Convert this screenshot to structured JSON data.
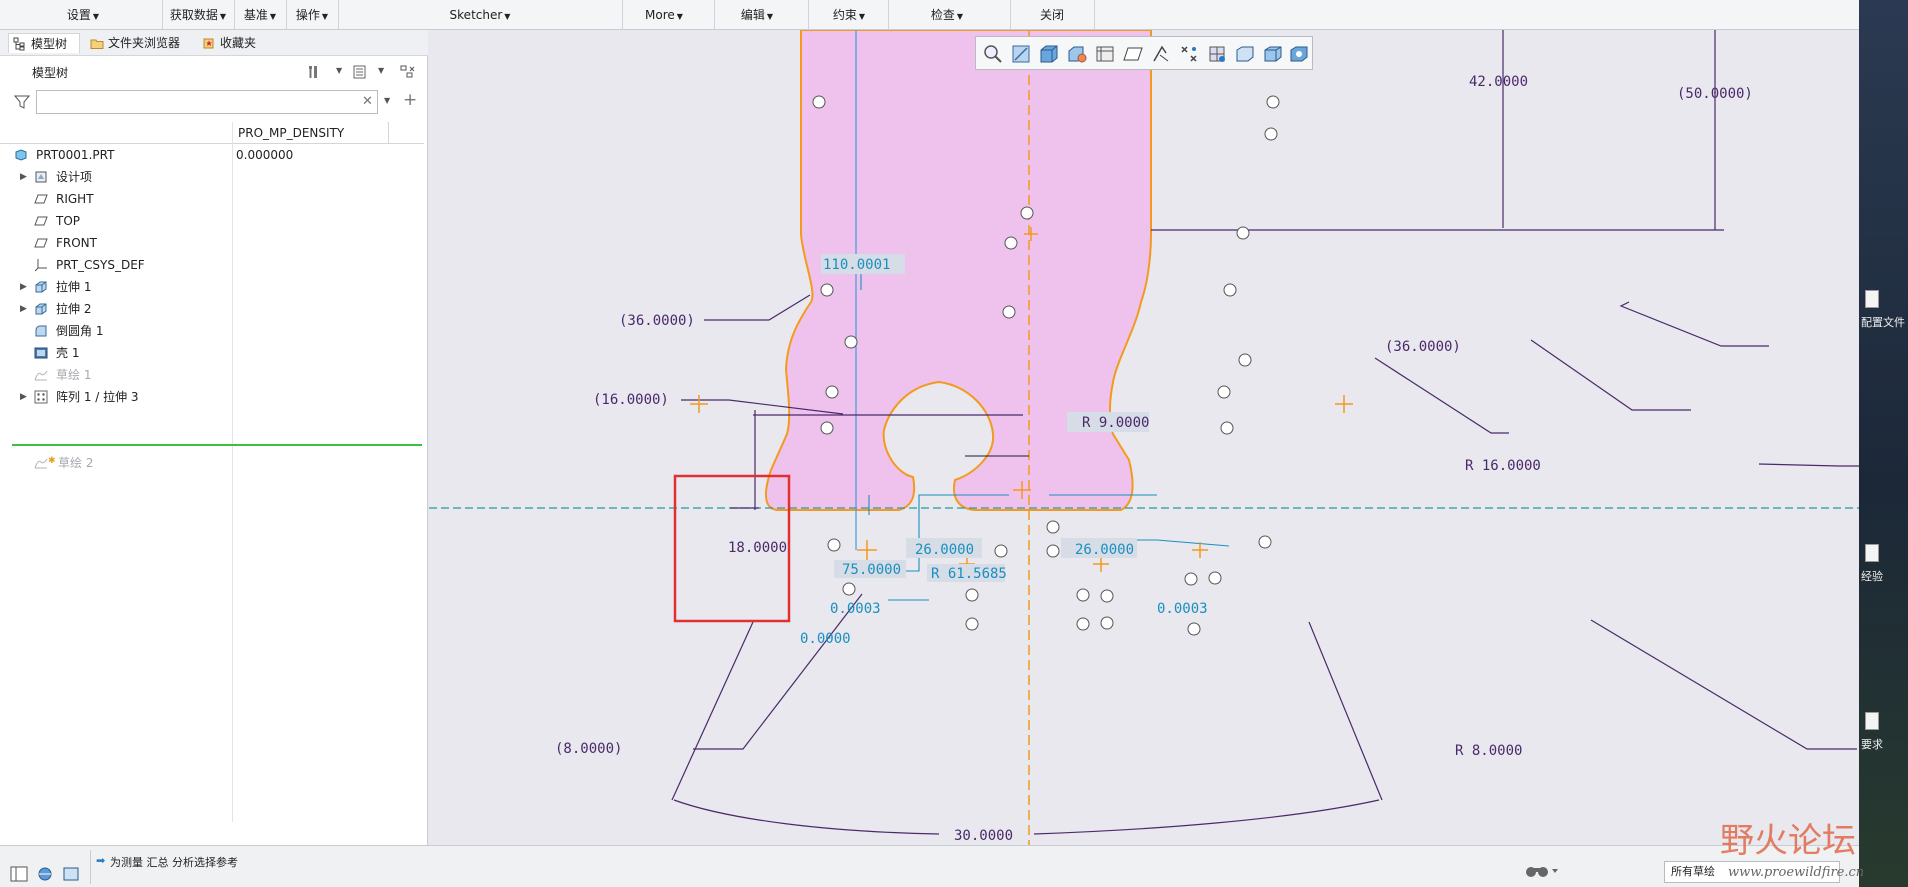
{
  "menubar": {
    "items": [
      {
        "label": "设置",
        "caret": true
      },
      {
        "label": "获取数据",
        "caret": true
      },
      {
        "label": "基准",
        "caret": true
      },
      {
        "label": "操作",
        "caret": true
      },
      {
        "label": "Sketcher",
        "caret": true
      },
      {
        "label": "More",
        "caret": true
      },
      {
        "label": "编辑",
        "caret": true
      },
      {
        "label": "约束",
        "caret": true
      },
      {
        "label": "检查",
        "caret": true
      },
      {
        "label": "关闭",
        "caret": false
      }
    ]
  },
  "panel": {
    "tabs": [
      {
        "label": "模型树",
        "icon": "tree-icon",
        "active": true
      },
      {
        "label": "文件夹浏览器",
        "icon": "folder-icon",
        "active": false
      },
      {
        "label": "收藏夹",
        "icon": "star-icon",
        "active": false
      }
    ],
    "tree_title": "模型树",
    "search_placeholder": "",
    "column_header": "PRO_MP_DENSITY",
    "tree_rows": [
      {
        "label": "PRT0001.PRT",
        "value": "0.000000",
        "icon": "part-icon",
        "expandable": false,
        "indent": 0,
        "dim": false
      },
      {
        "label": "设计项",
        "value": "",
        "icon": "design-items-icon",
        "expandable": true,
        "indent": 1,
        "dim": false
      },
      {
        "label": "RIGHT",
        "value": "",
        "icon": "datum-plane-icon",
        "expandable": false,
        "indent": 1,
        "dim": false
      },
      {
        "label": "TOP",
        "value": "",
        "icon": "datum-plane-icon",
        "expandable": false,
        "indent": 1,
        "dim": false
      },
      {
        "label": "FRONT",
        "value": "",
        "icon": "datum-plane-icon",
        "expandable": false,
        "indent": 1,
        "dim": false
      },
      {
        "label": "PRT_CSYS_DEF",
        "value": "",
        "icon": "csys-icon",
        "expandable": false,
        "indent": 1,
        "dim": false
      },
      {
        "label": "拉伸 1",
        "value": "",
        "icon": "extrude-icon",
        "expandable": true,
        "indent": 1,
        "dim": false
      },
      {
        "label": "拉伸 2",
        "value": "",
        "icon": "extrude-icon",
        "expandable": true,
        "indent": 1,
        "dim": false
      },
      {
        "label": "倒圆角 1",
        "value": "",
        "icon": "round-icon",
        "expandable": false,
        "indent": 1,
        "dim": false
      },
      {
        "label": "壳 1",
        "value": "",
        "icon": "shell-icon",
        "expandable": false,
        "indent": 1,
        "dim": false
      },
      {
        "label": "草绘 1",
        "value": "",
        "icon": "sketch-icon",
        "expandable": false,
        "indent": 1,
        "dim": true
      },
      {
        "label": "阵列 1 / 拉伸 3",
        "value": "",
        "icon": "pattern-icon",
        "expandable": true,
        "indent": 1,
        "dim": false
      }
    ],
    "active_sketch": {
      "label": "草绘 2",
      "icon": "sketch-icon",
      "dim": true
    }
  },
  "sketch": {
    "dimensions": [
      {
        "text": "42.0000",
        "color": "#4a2a6a"
      },
      {
        "text": "(50.0000)",
        "color": "#4a2a6a"
      },
      {
        "text": "110.0001",
        "color": "#1a8fc0"
      },
      {
        "text": "(36.0000)",
        "color": "#4a2a6a"
      },
      {
        "text": "(36.0000)",
        "color": "#4a2a6a"
      },
      {
        "text": "(16.0000)",
        "color": "#4a2a6a"
      },
      {
        "text": "R 9.0000",
        "color": "#4a2a6a"
      },
      {
        "text": "R 16.0000",
        "color": "#4a2a6a"
      },
      {
        "text": "18.0000",
        "color": "#4a2a6a"
      },
      {
        "text": "26.0000",
        "color": "#1a8fc0"
      },
      {
        "text": "26.0000",
        "color": "#1a8fc0"
      },
      {
        "text": "75.0000",
        "color": "#1a8fc0"
      },
      {
        "text": "R 61.5685",
        "color": "#1a8fc0"
      },
      {
        "text": "0.0003",
        "color": "#1a8fc0"
      },
      {
        "text": "0.0003",
        "color": "#1a8fc0"
      },
      {
        "text": "0.0000",
        "color": "#1a8fc0"
      },
      {
        "text": "(8.0000)",
        "color": "#4a2a6a"
      },
      {
        "text": "R 8.0000",
        "color": "#4a2a6a"
      },
      {
        "text": "30.0000",
        "color": "#4a2a6a"
      }
    ],
    "colors": {
      "fill": "#efc2ee",
      "outline": "#f39a1e",
      "centerline": "#f39a1e",
      "reference": "#1f9f9f",
      "dimension": "#4a2a6a",
      "weak_dimension": "#1a8fc0",
      "highlight_box": "#e03030"
    }
  },
  "gfx_toolbar": {
    "icons": [
      "zoom-in-icon",
      "zoom-fit-icon",
      "display-style-icon",
      "view-orient-icon",
      "named-view-icon",
      "datum-display-icon",
      "sketch-display-icon",
      "constraint-display-icon",
      "grid-icon",
      "spin-center-icon",
      "shading-icon",
      "refit-icon"
    ]
  },
  "rightstrip": {
    "items": [
      {
        "label": "配置文件"
      },
      {
        "label": "经验"
      },
      {
        "label": "要求"
      }
    ]
  },
  "statusbar": {
    "message": "为测量 汇总 分析选择参考",
    "filter_value": "所有草绘"
  },
  "watermark": {
    "main": "野火论坛",
    "url": "www.proewildfire.cn"
  }
}
